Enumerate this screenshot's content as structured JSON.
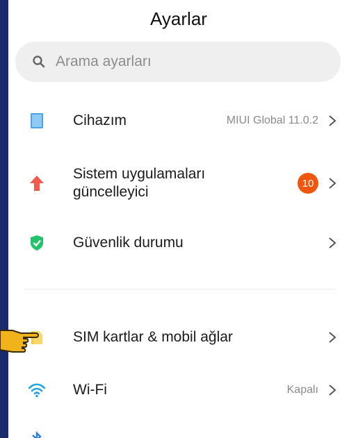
{
  "header": {
    "title": "Ayarlar"
  },
  "search": {
    "placeholder": "Arama ayarları",
    "icon": "search-icon"
  },
  "items": [
    {
      "label": "Cihazım",
      "value": "MIUI Global 11.0.2",
      "icon": "tablet-icon",
      "icon_color": "#4aa3e6"
    },
    {
      "label": "Sistem uygulamaları güncelleyici",
      "badge": "10",
      "icon": "arrow-up-icon",
      "icon_color": "#f25a4b"
    },
    {
      "label": "Güvenlik durumu",
      "icon": "shield-check-icon",
      "icon_color": "#22c36b"
    },
    {
      "label": "SIM kartlar & mobil ağlar",
      "icon": "sim-card-icon",
      "icon_color": "#f5c842"
    },
    {
      "label": "Wi-Fi",
      "value": "Kapalı",
      "icon": "wifi-icon",
      "icon_color": "#1fa3e8"
    }
  ],
  "colors": {
    "badge": "#f0570c",
    "frame": "#1b2a6b",
    "pointer": "#f0b31a"
  }
}
